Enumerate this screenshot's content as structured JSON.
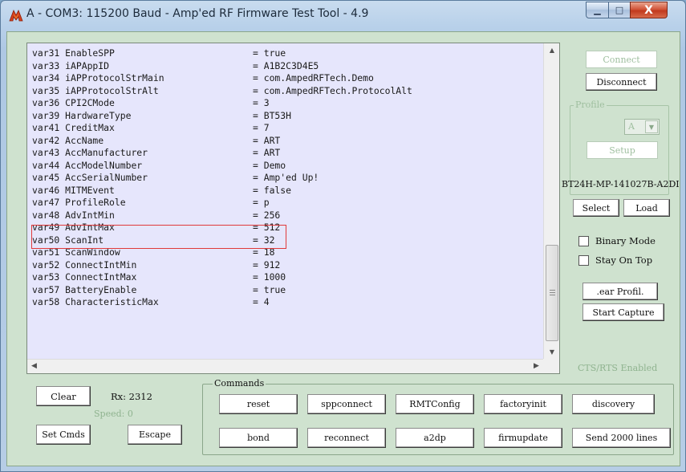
{
  "window": {
    "title": "A - COM3: 115200 Baud - Amp'ed RF Firmware Test Tool - 4.9",
    "minimize_glyph": "▁",
    "maximize_glyph": "□",
    "close_glyph": "X"
  },
  "log": {
    "lines": [
      {
        "key": "var31 EnableSPP",
        "value": "= true"
      },
      {
        "key": "var33 iAPAppID",
        "value": "= A1B2C3D4E5"
      },
      {
        "key": "var34 iAPProtocolStrMain",
        "value": "= com.AmpedRFTech.Demo"
      },
      {
        "key": "var35 iAPProtocolStrAlt",
        "value": "= com.AmpedRFTech.ProtocolAlt"
      },
      {
        "key": "var36 CPI2CMode",
        "value": "= 3"
      },
      {
        "key": "var39 HardwareType",
        "value": "= BT53H"
      },
      {
        "key": "var41 CreditMax",
        "value": "= 7"
      },
      {
        "key": "var42 AccName",
        "value": "= ART"
      },
      {
        "key": "var43 AccManufacturer",
        "value": "= ART"
      },
      {
        "key": "var44 AccModelNumber",
        "value": "= Demo"
      },
      {
        "key": "var45 AccSerialNumber",
        "value": "= Amp'ed Up!"
      },
      {
        "key": "var46 MITMEvent",
        "value": "= false"
      },
      {
        "key": "var47 ProfileRole",
        "value": "= p"
      },
      {
        "key": "var48 AdvIntMin",
        "value": "= 256"
      },
      {
        "key": "var49 AdvIntMax",
        "value": "= 512"
      },
      {
        "key": "var50 ScanInt",
        "value": "= 32"
      },
      {
        "key": "var51 ScanWindow",
        "value": "= 18"
      },
      {
        "key": "var52 ConnectIntMin",
        "value": "= 912"
      },
      {
        "key": "var53 ConnectIntMax",
        "value": "= 1000"
      },
      {
        "key": "var57 BatteryEnable",
        "value": "= true"
      },
      {
        "key": "var58 CharacteristicMax",
        "value": "= 4"
      }
    ],
    "highlighted_line_index": 12,
    "highlight_color": "#e03a3a",
    "background_color": "#e6e6fc"
  },
  "right_panel": {
    "connect_label": "Connect",
    "disconnect_label": "Disconnect",
    "profile_group_label": "Profile",
    "profile_value": "A",
    "setup_label": "Setup",
    "firmware_id": "BT24H-MP-141027B-A2DI",
    "select_label": "Select",
    "load_label": "Load",
    "binary_mode_label": "Binary Mode",
    "binary_mode_checked": false,
    "stay_on_top_label": "Stay On Top",
    "stay_on_top_checked": false,
    "clear_profile_label": ".ear Profil.",
    "start_capture_label": "Start Capture",
    "cts_rts_status": "CTS/RTS Enabled"
  },
  "bottom": {
    "clear_label": "Clear",
    "rx_label": "Rx: 2312",
    "speed_label": "Speed: 0",
    "set_cmds_label": "Set Cmds",
    "escape_label": "Escape",
    "commands_group_label": "Commands",
    "commands_row1": [
      "reset",
      "sppconnect",
      "RMTConfig",
      "factoryinit",
      "discovery"
    ],
    "commands_row2": [
      "bond",
      "reconnect",
      "a2dp",
      "firmupdate",
      "Send 2000 lines"
    ]
  }
}
